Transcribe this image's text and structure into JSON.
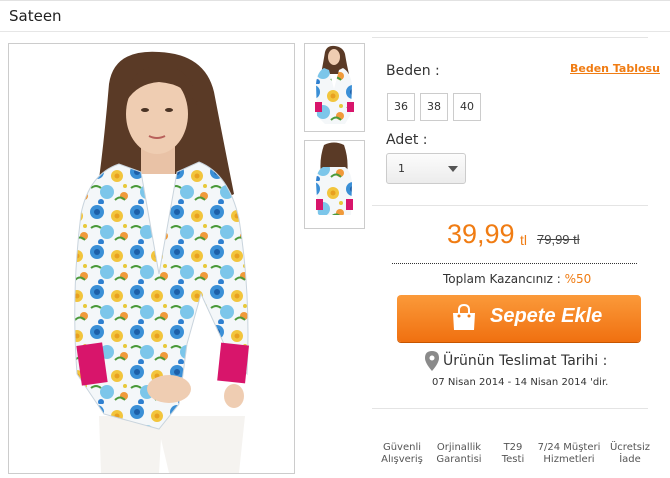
{
  "brand": "Sateen",
  "images": {
    "main_alt": "product-main-image",
    "thumbnails": [
      "thumb-front",
      "thumb-back"
    ]
  },
  "size": {
    "label": "Beden :",
    "chart_link": "Beden Tablosu",
    "options": [
      "36",
      "38",
      "40"
    ]
  },
  "quantity": {
    "label": "Adet :",
    "selected": "1"
  },
  "price": {
    "current": "39,99",
    "currency": "tl",
    "old": "79,99 tl"
  },
  "savings": {
    "label": "Toplam Kazancınız :",
    "percent": "%50"
  },
  "cart_button": "Sepete Ekle",
  "delivery": {
    "title": "Ürünün Teslimat Tarihi :",
    "date": "07 Nisan 2014 - 14 Nisan 2014 'dir."
  },
  "features": [
    {
      "line1": "Güvenli",
      "line2": "Alışveriş"
    },
    {
      "line1": "Orjinallik",
      "line2": "Garantisi"
    },
    {
      "line1": "T29",
      "line2": "Testi"
    },
    {
      "line1": "7/24 Müşteri",
      "line2": "Hizmetleri"
    },
    {
      "line1": "Ücretsiz",
      "line2": "İade"
    }
  ],
  "colors": {
    "accent": "#f07c13",
    "button_top": "#fb9a3a",
    "button_bottom": "#f07010"
  }
}
